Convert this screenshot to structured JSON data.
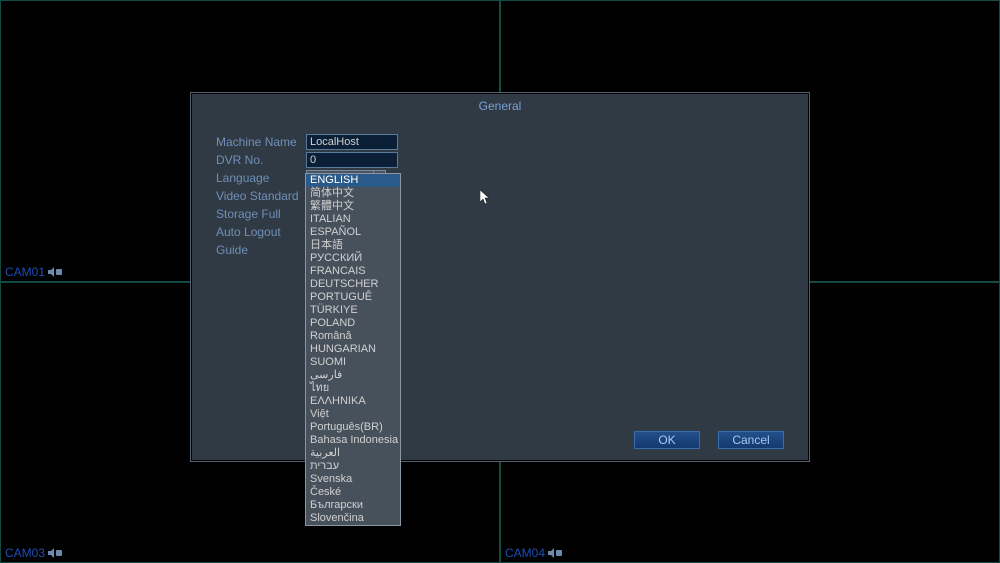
{
  "cameras": {
    "cam1": "CAM01",
    "cam2": "",
    "cam3": "CAM03",
    "cam4": "CAM04"
  },
  "dialog": {
    "title": "General",
    "labels": {
      "machineName": "Machine Name",
      "dvrNo": "DVR No.",
      "language": "Language",
      "videoStandard": "Video Standard",
      "storageFull": "Storage Full",
      "autoLogout": "Auto Logout",
      "guide": "Guide"
    },
    "values": {
      "machineName": "LocalHost",
      "dvrNo": "0",
      "language": "ENGLISH"
    },
    "buttons": {
      "ok": "OK",
      "cancel": "Cancel"
    }
  },
  "languages": [
    "ENGLISH",
    "简体中文",
    "繁體中文",
    "ITALIAN",
    "ESPAÑOL",
    "日本語",
    "РУССКИЙ",
    "FRANCAIS",
    "DEUTSCHER",
    "PORTUGUÊ",
    "TÜRKIYE",
    "POLAND",
    "Română",
    "HUNGARIAN",
    "SUOMI",
    "فارسی",
    "ไทย",
    "ΕΛΛΗΝΙΚΑ",
    "Việt",
    "Português(BR)",
    "Bahasa Indonesia",
    "العربية",
    "עברית",
    "Svenska",
    "České",
    "Български",
    "Slovenčina"
  ]
}
